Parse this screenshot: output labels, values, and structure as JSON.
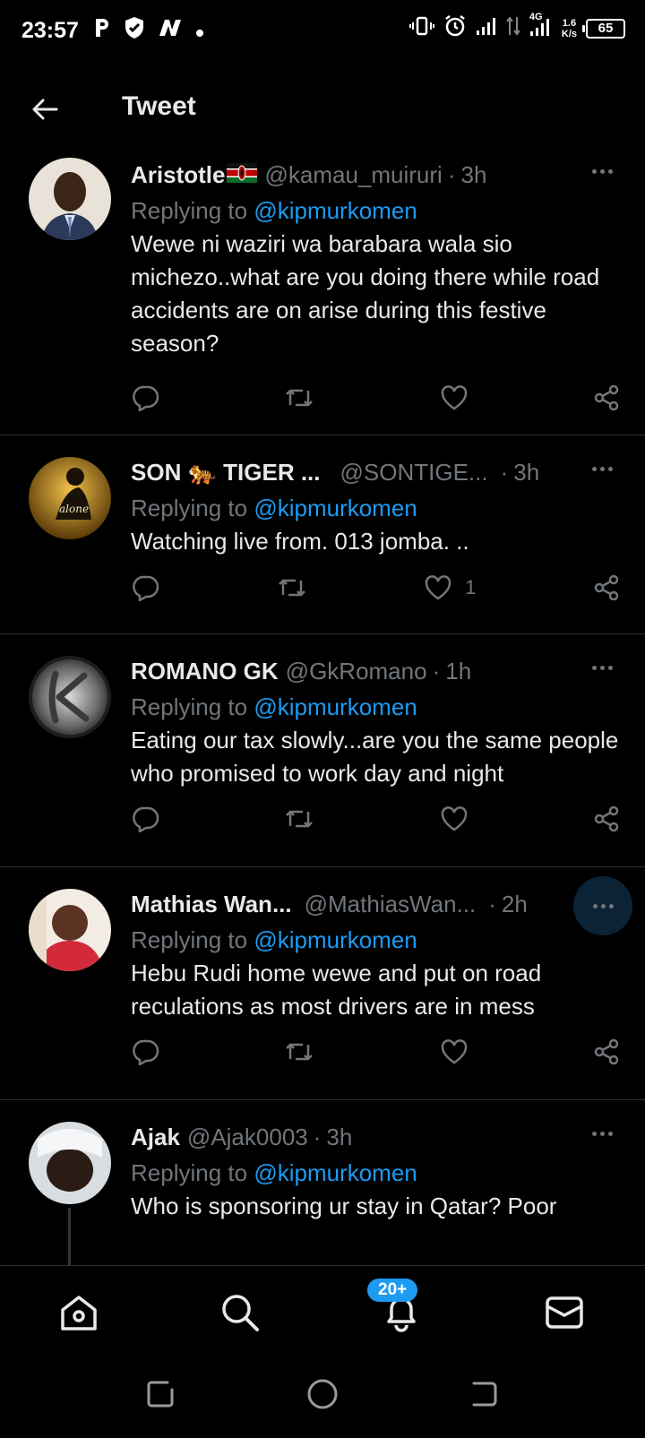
{
  "status_bar": {
    "time": "23:57",
    "left_icons": [
      "parking-app-icon",
      "shield-app-icon",
      "news-app-icon",
      "dot-icon"
    ],
    "network_speed": "1.6",
    "network_speed_unit": "K/s",
    "network_type": "4G",
    "battery": "65"
  },
  "header": {
    "title": "Tweet"
  },
  "tweets": [
    {
      "name": "Aristotle",
      "flag": "kenya-flag-icon",
      "handle": "@kamau_muiruri",
      "dot": "·",
      "time": "3h",
      "replying_prefix": "Replying to ",
      "replying_to": "@kipmurkomen",
      "text": "Wewe ni waziri wa barabara wala sio michezo..what are you doing there while road  accidents are on arise during this festive season?",
      "like_count": ""
    },
    {
      "name": "SON 🐅 TIGER ...",
      "handle": "@SONTIGE...",
      "dot": "·",
      "time": "3h",
      "replying_prefix": "Replying to ",
      "replying_to": "@kipmurkomen",
      "text": "Watching live from. 013 jomba.  ..",
      "like_count": "1"
    },
    {
      "name": "ROMANO GK",
      "handle": "@GkRomano",
      "dot": "·",
      "time": "1h",
      "replying_prefix": "Replying to ",
      "replying_to": "@kipmurkomen",
      "text": "Eating our tax slowly...are you the same people who promised to work day and night",
      "like_count": ""
    },
    {
      "name": "Mathias Wan...",
      "handle": "@MathiasWan...",
      "dot": "·",
      "time": "2h",
      "replying_prefix": "Replying to ",
      "replying_to": "@kipmurkomen",
      "text": "Hebu Rudi home wewe and put on road reculations as most drivers are in mess",
      "like_count": ""
    },
    {
      "name": "Ajak",
      "handle": "@Ajak0003",
      "dot": "·",
      "time": "3h",
      "replying_prefix": "Replying to ",
      "replying_to": "@kipmurkomen",
      "text": "Who is sponsoring ur stay in Qatar? Poor",
      "like_count": ""
    }
  ],
  "bottom_nav": {
    "items": [
      "home-icon",
      "search-icon",
      "notifications-icon",
      "messages-icon"
    ],
    "notification_badge": "20+"
  },
  "colors": {
    "background": "#000000",
    "text_primary": "#e7e9ea",
    "text_secondary": "#71767b",
    "accent": "#1d9bf0",
    "divider": "#2f3336"
  }
}
